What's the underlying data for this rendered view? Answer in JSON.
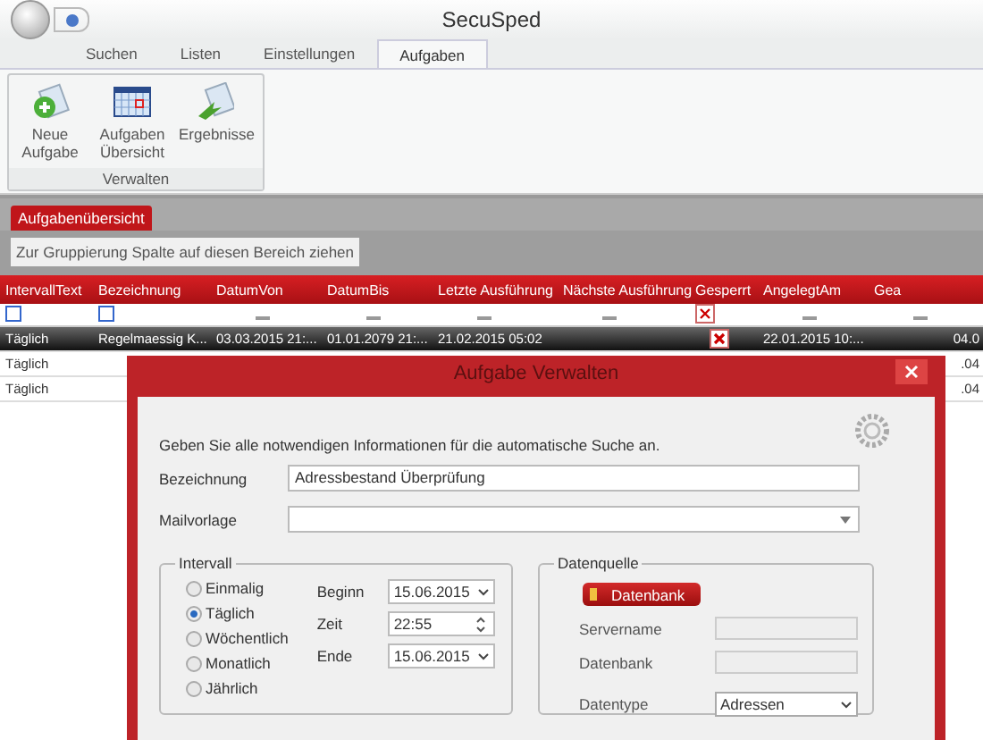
{
  "window": {
    "title": "SecuSped"
  },
  "tabs": [
    {
      "label": "Suchen",
      "selected": false
    },
    {
      "label": "Listen",
      "selected": false
    },
    {
      "label": "Einstellungen",
      "selected": false
    },
    {
      "label": "Aufgaben",
      "selected": true
    }
  ],
  "ribbon": {
    "buttons": [
      {
        "label": "Neue Aufgabe",
        "kind": "new"
      },
      {
        "label": "Aufgaben Übersicht",
        "kind": "calendar"
      },
      {
        "label": "Ergebnisse",
        "kind": "results"
      }
    ],
    "group_label": "Verwalten"
  },
  "document_tab": "Aufgabenübersicht",
  "group_panel": "Zur Gruppierung Spalte auf diesen Bereich ziehen",
  "table": {
    "columns": [
      {
        "label": "IntervallText",
        "kind": "text"
      },
      {
        "label": "Bezeichnung",
        "kind": "text"
      },
      {
        "label": "DatumVon",
        "kind": "date"
      },
      {
        "label": "DatumBis",
        "kind": "date"
      },
      {
        "label": "Letzte Ausführung",
        "kind": "date"
      },
      {
        "label": "Nächste Ausführung",
        "kind": "date"
      },
      {
        "label": "Gesperrt",
        "kind": "check"
      },
      {
        "label": "AngelegtAm",
        "kind": "date"
      },
      {
        "label": "Gea",
        "kind": "date"
      }
    ],
    "rows": [
      {
        "selected": true,
        "locked": true,
        "cells": [
          "Täglich",
          "Regelmaessig K...",
          "03.03.2015 21:...",
          "01.01.2079 21:...",
          "21.02.2015 05:02",
          "",
          "",
          "22.01.2015 10:...",
          "04.0"
        ]
      },
      {
        "selected": false,
        "cells": [
          "Täglich",
          "",
          "",
          "",
          "",
          "",
          "",
          "",
          ".04"
        ]
      },
      {
        "selected": false,
        "cells": [
          "Täglich",
          "",
          "",
          "",
          "",
          "",
          "",
          "",
          ".04"
        ]
      }
    ]
  },
  "dialog": {
    "title": "Aufgabe Verwalten",
    "intro": "Geben Sie alle notwendigen Informationen für die automatische Suche an.",
    "name_label": "Bezeichnung",
    "name_value": "Adressbestand Überprüfung",
    "mail_label": "Mailvorlage",
    "interval": {
      "legend": "Intervall",
      "options": [
        {
          "label": "Einmalig",
          "selected": false
        },
        {
          "label": "Täglich",
          "selected": true
        },
        {
          "label": "Wöchentlich",
          "selected": false
        },
        {
          "label": "Monatlich",
          "selected": false
        },
        {
          "label": "Jährlich",
          "selected": false
        }
      ],
      "fields": [
        {
          "label": "Beginn",
          "value": "15.06.2015",
          "kind": "date"
        },
        {
          "label": "Zeit",
          "value": "22:55",
          "kind": "time"
        },
        {
          "label": "Ende",
          "value": "15.06.2015",
          "kind": "date"
        }
      ]
    },
    "source": {
      "legend": "Datenquelle",
      "button": "Datenbank",
      "server_label": "Servername",
      "db_label": "Datenbank",
      "type_label": "Datentype",
      "type_value": "Adressen"
    }
  }
}
